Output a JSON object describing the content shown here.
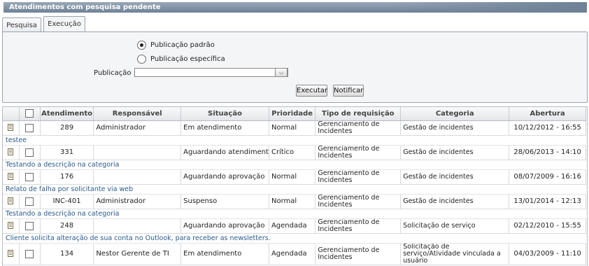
{
  "title": "Atendimentos com pesquisa pendente",
  "tabs": [
    "Pesquisa",
    "Execução"
  ],
  "form": {
    "radio_default": "Publicação padrão",
    "radio_specific": "Publicação específica",
    "pub_label": "Publicação :",
    "pub_value": "",
    "execute": "Executar",
    "notify": "Notificar"
  },
  "columns": [
    "Atendimento",
    "Responsável",
    "Situação",
    "Prioridade",
    "Tipo de requisição",
    "Categoria",
    "Abertura"
  ],
  "rows": [
    {
      "id": "289",
      "resp": "Administrador",
      "sit": "Em atendimento",
      "prio": "Normal",
      "tipo": "Gerenciamento de Incidentes",
      "cat": "Gestão de incidentes",
      "abertura": "10/12/2012 - 16:55",
      "desc": "testee"
    },
    {
      "id": "331",
      "resp": "",
      "sit": "Aguardando atendimento",
      "prio": "Crítico",
      "tipo": "Gerenciamento de Incidentes",
      "cat": "Gestão de incidentes",
      "abertura": "28/06/2013 - 14:10",
      "desc": "Testando a descrição na categoria"
    },
    {
      "id": "176",
      "resp": "",
      "sit": "Aguardando aprovação",
      "prio": "Normal",
      "tipo": "Gerenciamento de Incidentes",
      "cat": "Gestão de incidentes",
      "abertura": "08/07/2009 - 16:16",
      "desc": "Relato de falha por solicitante via web"
    },
    {
      "id": "INC-401",
      "resp": "Administrador",
      "sit": "Suspenso",
      "prio": "Normal",
      "tipo": "Gerenciamento de Incidentes",
      "cat": "Gestão de incidentes",
      "abertura": "13/01/2014 - 12:13",
      "desc": "Testando a descrição na categoria"
    },
    {
      "id": "248",
      "resp": "",
      "sit": "Aguardando aprovação",
      "prio": "Agendada",
      "tipo": "Gerenciamento de Incidentes",
      "cat": "Solicitação de serviço",
      "abertura": "02/12/2010 - 15:55",
      "desc": "Cliente solicita alteração de sua conta no Outlook, para receber as newsletters."
    },
    {
      "id": "134",
      "resp": "Nestor Gerente de TI",
      "sit": "Em atendimento",
      "prio": "Agendada",
      "tipo": "Gerenciamento de Incidentes",
      "cat": "Solicitação de serviço/Atividade vinculada a usuário",
      "abertura": "04/03/2009 - 11:10",
      "desc": ""
    }
  ]
}
